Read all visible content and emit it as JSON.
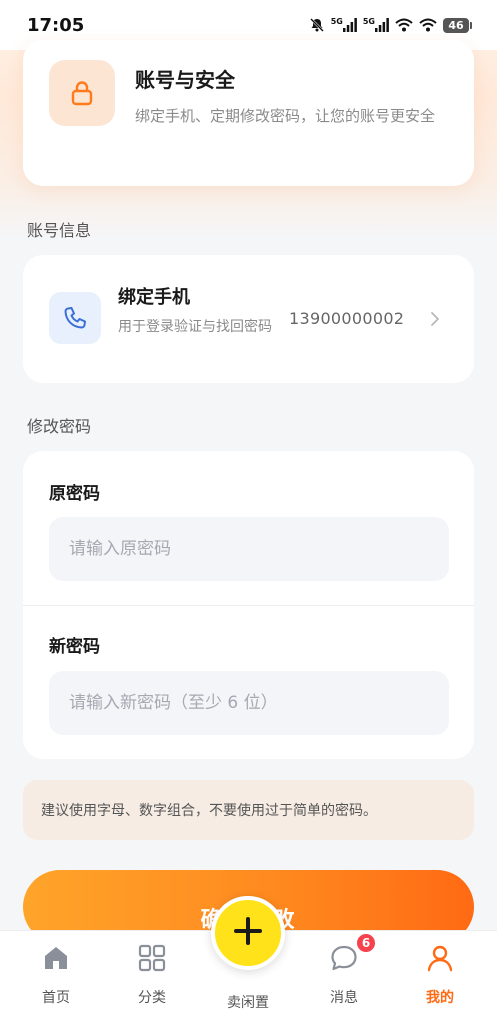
{
  "status_bar": {
    "time": "17:05",
    "signal1_label": "5G",
    "signal2_label": "5G",
    "battery": "46",
    "icons": [
      "mute-bell-icon",
      "signal-icon",
      "signal-icon",
      "wifi-icon",
      "wifi-icon",
      "battery-icon"
    ]
  },
  "hero": {
    "icon": "lock-icon",
    "title": "账号与安全",
    "description": "绑定手机、定期修改密码，让您的账号更安全"
  },
  "account_section": {
    "label": "账号信息",
    "phone": {
      "icon": "phone-icon",
      "title": "绑定手机",
      "description": "用于登录验证与找回密码",
      "number": "13900000002"
    }
  },
  "password_section": {
    "label": "修改密码",
    "old_password": {
      "label": "原密码",
      "placeholder": "请输入原密码",
      "value": ""
    },
    "new_password": {
      "label": "新密码",
      "placeholder": "请输入新密码（至少 6 位）",
      "value": ""
    }
  },
  "tip": "建议使用字母、数字组合，不要使用过于简单的密码。",
  "submit_label": "确认修改",
  "tabbar": {
    "items": [
      {
        "label": "首页",
        "icon": "home-icon"
      },
      {
        "label": "分类",
        "icon": "grid-icon"
      },
      {
        "label": "卖闲置",
        "icon": "plus-icon"
      },
      {
        "label": "消息",
        "icon": "chat-icon",
        "badge": "6"
      },
      {
        "label": "我的",
        "icon": "user-icon",
        "active": true
      }
    ]
  },
  "colors": {
    "accent": "#ff6a14",
    "sell_button": "#ffe21a",
    "badge": "#f5424d"
  }
}
